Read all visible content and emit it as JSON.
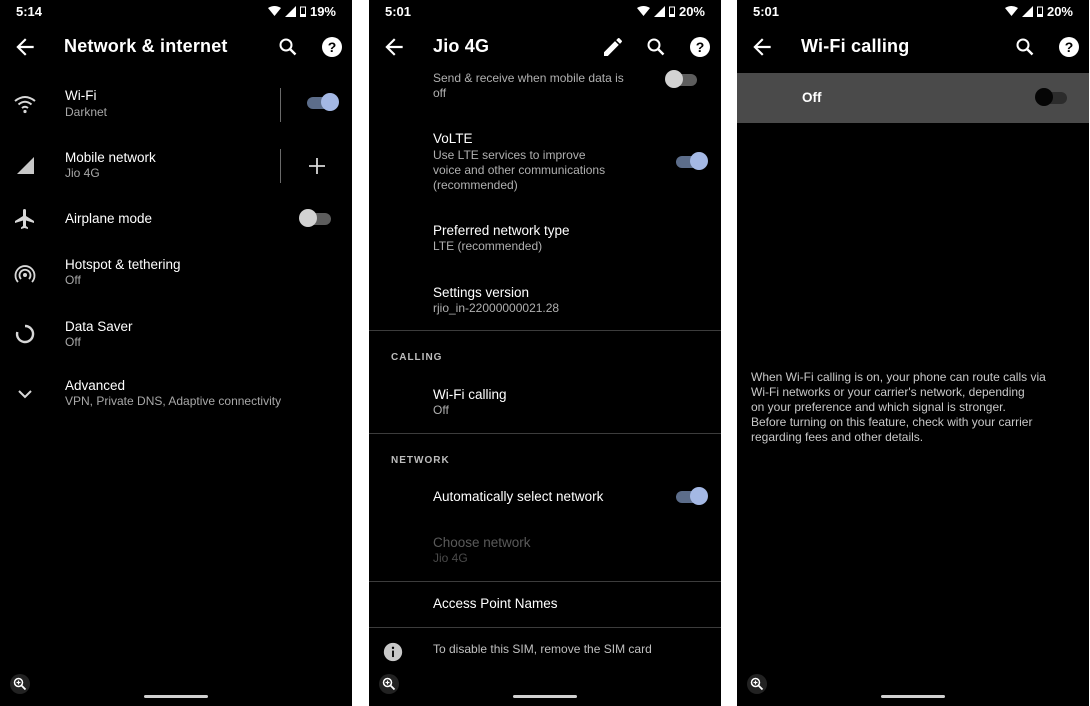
{
  "screens": [
    {
      "time": "5:14",
      "battery": "19%",
      "title": "Network & internet",
      "items": [
        {
          "title": "Wi-Fi",
          "subtitle": "Darknet"
        },
        {
          "title": "Mobile network",
          "subtitle": "Jio 4G"
        },
        {
          "title": "Airplane mode"
        },
        {
          "title": "Hotspot & tethering",
          "subtitle": "Off"
        },
        {
          "title": "Data Saver",
          "subtitle": "Off"
        },
        {
          "title": "Advanced",
          "subtitle": "VPN, Private DNS, Adaptive connectivity"
        }
      ]
    },
    {
      "time": "5:01",
      "battery": "20%",
      "title": "Jio 4G",
      "items": [
        {
          "subtitle_line1": "Send & receive when mobile data is",
          "subtitle_line2": "off"
        },
        {
          "title": "VoLTE",
          "subtitle_line1": "Use LTE services to improve",
          "subtitle_line2": "voice and other communications",
          "subtitle_line3": "(recommended)"
        },
        {
          "title": "Preferred network type",
          "subtitle": "LTE (recommended)"
        },
        {
          "title": "Settings version",
          "subtitle": "rjio_in-22000000021.28"
        }
      ],
      "calling_header": "CALLING",
      "wifi_calling": {
        "title": "Wi-Fi calling",
        "subtitle": "Off"
      },
      "network_header": "NETWORK",
      "auto_select": {
        "title": "Automatically select network"
      },
      "choose_network": {
        "title": "Choose network",
        "subtitle": "Jio 4G"
      },
      "apn": {
        "title": "Access Point Names"
      },
      "sim_note": "To disable this SIM, remove the SIM card"
    },
    {
      "time": "5:01",
      "battery": "20%",
      "title": "Wi-Fi calling",
      "toggle_label": "Off",
      "info_lines": [
        "When Wi-Fi calling is on, your phone can route calls via",
        "Wi-Fi networks or your carrier's network, depending",
        "on your preference and which signal is stronger.",
        "Before turning on this feature, check with your carrier",
        "regarding fees and other details."
      ]
    }
  ],
  "toggles": {
    "wifi": "on",
    "airplane_mode": "off",
    "mobile_data_roaming": "off",
    "volte": "on",
    "auto_select_network": "on",
    "wifi_calling": "off"
  },
  "colors": {
    "background": "#000000",
    "switch_on_knob": "#a4b8e4",
    "switch_on_track": "#5c6d8a",
    "banner": "#4a4a4a"
  }
}
